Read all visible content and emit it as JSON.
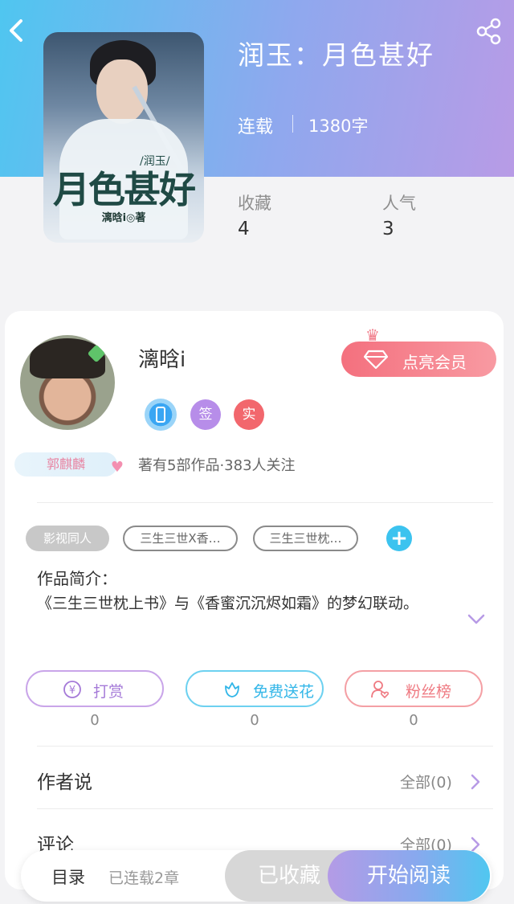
{
  "header": {
    "back_icon": "chevron-left-icon",
    "share_icon": "share-icon"
  },
  "book": {
    "title": "润玉：月色甚好",
    "status": "连载",
    "word_count": "1380字",
    "cover": {
      "title_art": "月色甚好",
      "subtitle": "/润玉/",
      "author_mark": "漓晗i◎著"
    },
    "stats": [
      {
        "label": "收藏",
        "value": "4"
      },
      {
        "label": "人气",
        "value": "3"
      }
    ]
  },
  "author": {
    "name": "漓晗i",
    "vip_button": "点亮会员",
    "badges": [
      {
        "icon": "phone-badge-icon",
        "text": ""
      },
      {
        "icon": "sign-badge-icon",
        "text": "签",
        "color": "#b78de9"
      },
      {
        "icon": "verified-badge-icon",
        "text": "实",
        "color": "#f2676d"
      }
    ],
    "fan_tag": "郭麒麟",
    "stats_text": "著有5部作品·383人关注"
  },
  "tags": [
    "影视同人",
    "三生三世X香…",
    "三生三世枕…"
  ],
  "intro": {
    "title": "作品简介：",
    "text": "《三生三世枕上书》与《香蜜沉沉烬如霜》的梦幻联动。"
  },
  "actions": [
    {
      "label": "打赏",
      "count": "0",
      "icon": "yen-icon",
      "color": "#a57ad8"
    },
    {
      "label": "免费送花",
      "count": "0",
      "icon": "flower-icon",
      "color": "#32b6e8"
    },
    {
      "label": "粉丝榜",
      "count": "0",
      "icon": "fans-icon",
      "color": "#ef7a82"
    }
  ],
  "rows": [
    {
      "title": "作者说",
      "more": "全部(0)"
    },
    {
      "title": "评论",
      "more": "全部(0)"
    }
  ],
  "bottom_bar": {
    "toc": "目录",
    "chapters": "已连载2章",
    "saved": "已收藏",
    "read": "开始阅读"
  },
  "colors": {
    "header_gradient": [
      "#4fc6f0",
      "#b89be6"
    ],
    "vip": "#f4707e",
    "accent_blue": "#3cc3ef"
  }
}
